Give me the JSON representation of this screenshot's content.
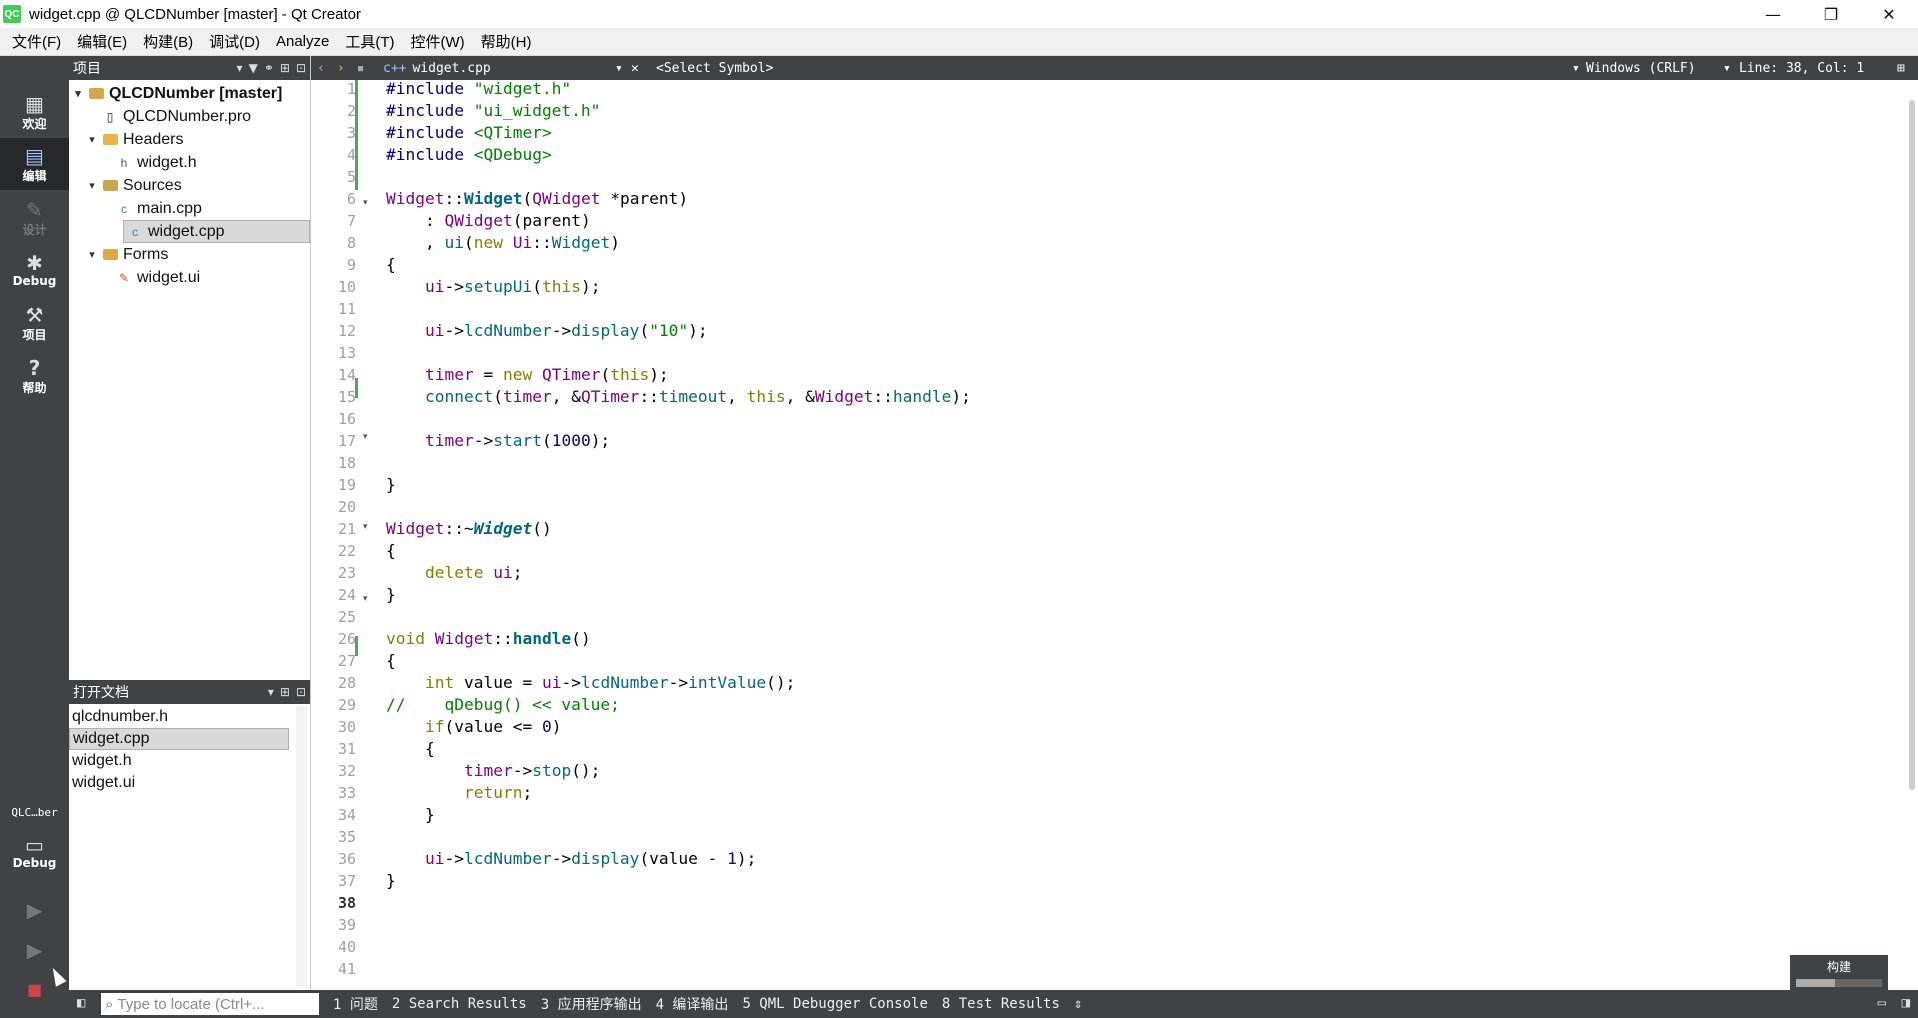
{
  "window": {
    "app_icon": "QC",
    "title": "widget.cpp @ QLCDNumber [master] - Qt Creator",
    "min": "—",
    "max": "❐",
    "close": "✕"
  },
  "menu": [
    "文件(F)",
    "编辑(E)",
    "构建(B)",
    "调试(D)",
    "Analyze",
    "工具(T)",
    "控件(W)",
    "帮助(H)"
  ],
  "modes": {
    "welcome": "欢迎",
    "edit": "编辑",
    "design": "设计",
    "debug": "Debug",
    "projects": "项目",
    "help": "帮助",
    "kit_name": "QLC…ber",
    "kit_mode": "Debug"
  },
  "project_pane": {
    "title": "项目",
    "tree": [
      {
        "label": "QLCDNumber [master]",
        "icon": "project-folder-icon"
      },
      {
        "label": "QLCDNumber.pro",
        "icon": "pro-file-icon"
      },
      {
        "label": "Headers",
        "icon": "folder-icon"
      },
      {
        "label": "widget.h",
        "icon": "header-file-icon"
      },
      {
        "label": "Sources",
        "icon": "folder-icon"
      },
      {
        "label": "main.cpp",
        "icon": "cpp-file-icon"
      },
      {
        "label": "widget.cpp",
        "icon": "cpp-file-icon"
      },
      {
        "label": "Forms",
        "icon": "folder-icon"
      },
      {
        "label": "widget.ui",
        "icon": "ui-file-icon"
      }
    ]
  },
  "open_docs": {
    "title": "打开文档",
    "items": [
      "qlcdnumber.h",
      "widget.cpp",
      "widget.h",
      "widget.ui"
    ],
    "selected_index": 1
  },
  "editor_toolbar": {
    "file": "widget.cpp",
    "symbol": "<Select Symbol>",
    "line_ending": "Windows (CRLF)",
    "position": "Line: 38, Col: 1"
  },
  "editor": {
    "current_line": 38,
    "line_numbers": [
      "1",
      "2",
      "3",
      "4",
      "5",
      "6",
      "7",
      "8",
      "9",
      "10",
      "11",
      "12",
      "13",
      "14",
      "15",
      "16",
      "17",
      "18",
      "19",
      "20",
      "21",
      "22",
      "23",
      "24",
      "25",
      "26",
      "27",
      "28",
      "29",
      "30",
      "31",
      "32",
      "33",
      "34",
      "35",
      "36",
      "37",
      "38",
      "39",
      "40",
      "41"
    ],
    "lines": [
      "#include \"widget.h\"",
      "#include \"ui_widget.h\"",
      "#include <QTimer>",
      "#include <QDebug>",
      "",
      "Widget::Widget(QWidget *parent)",
      "    : QWidget(parent)",
      "    , ui(new Ui::Widget)",
      "{",
      "    ui->setupUi(this);",
      "",
      "    ui->lcdNumber->display(\"10\");",
      "",
      "    timer = new QTimer(this);",
      "    connect(timer, &QTimer::timeout, this, &Widget::handle);",
      "",
      "    timer->start(1000);",
      "",
      "}",
      "",
      "Widget::~Widget()",
      "{",
      "    delete ui;",
      "}",
      "",
      "void Widget::handle()",
      "{",
      "    int value = ui->lcdNumber->intValue();",
      "//    qDebug() << value;",
      "    if(value <= 0)",
      "    {",
      "        timer->stop();",
      "        return;",
      "    }",
      "",
      "    ui->lcdNumber->display(value - 1);",
      "}",
      "",
      "",
      "",
      ""
    ]
  },
  "build_box": {
    "label": "构建",
    "progress": 0.45
  },
  "statusbar": {
    "locate_placeholder": "Type to locate (Ctrl+...",
    "tabs": [
      "1 问题",
      "2 Search Results",
      "3 应用程序输出",
      "4 编译输出",
      "5 QML Debugger Console",
      "8 Test Results"
    ]
  }
}
